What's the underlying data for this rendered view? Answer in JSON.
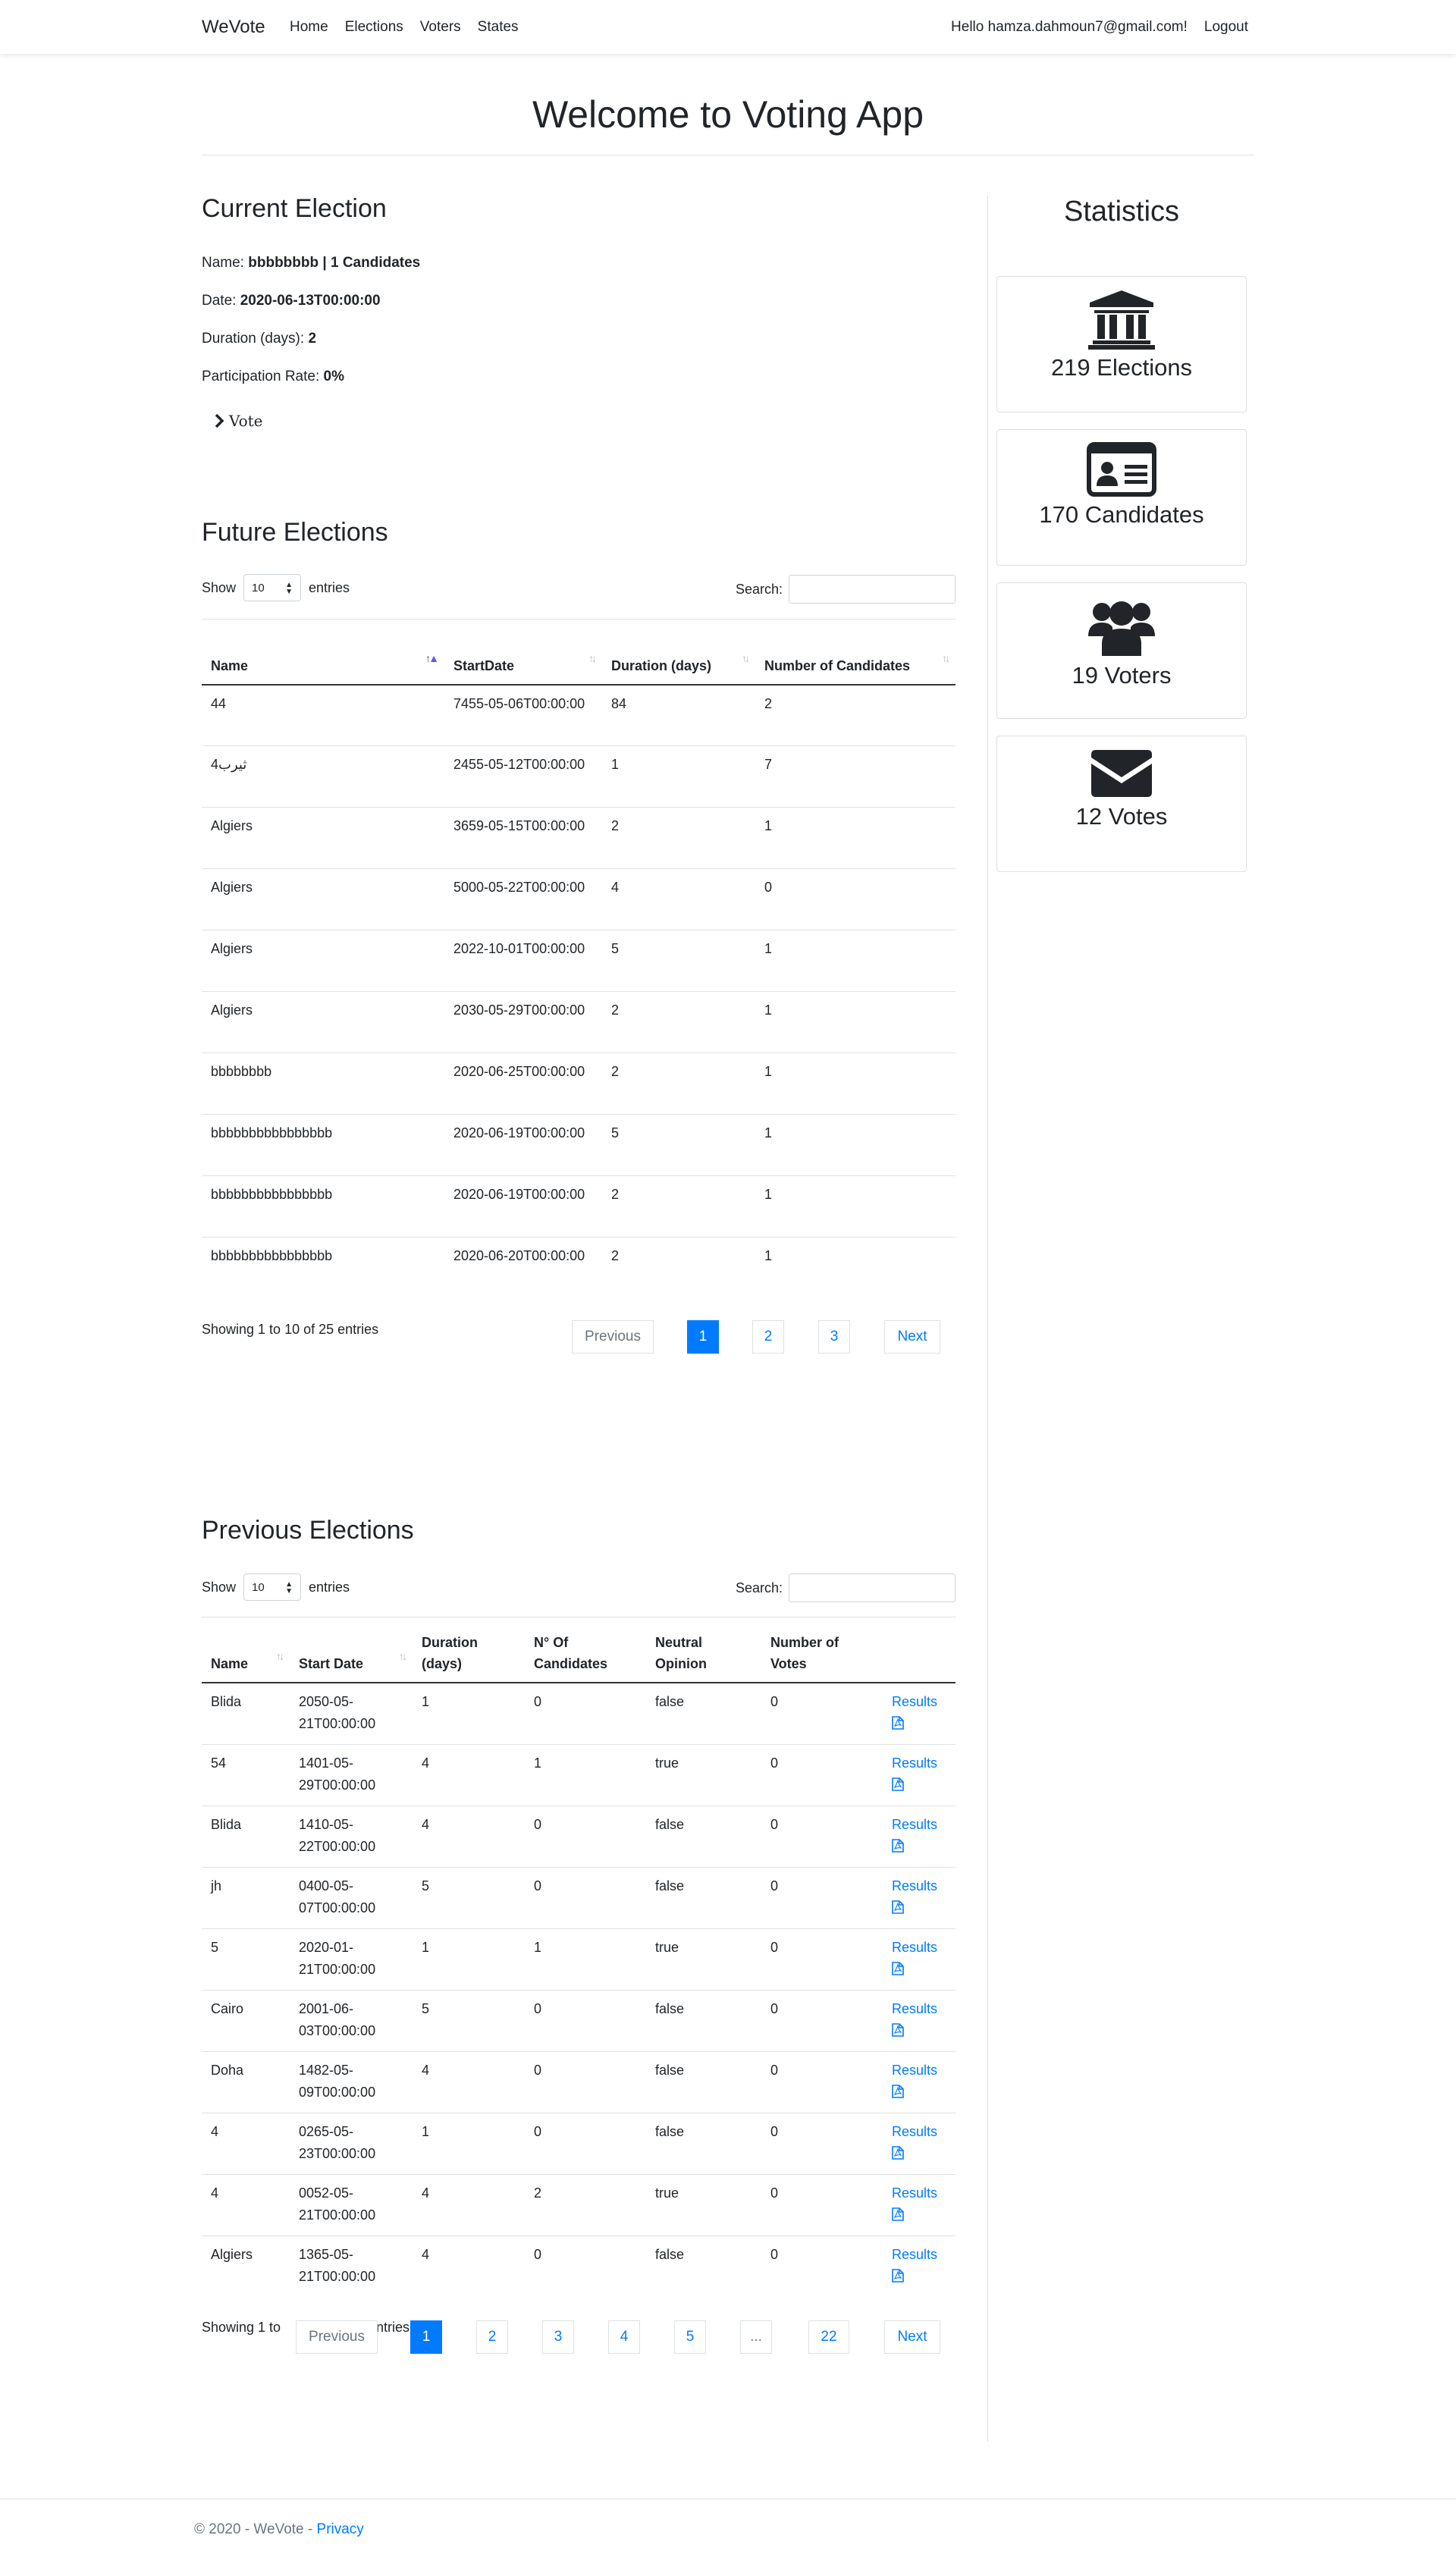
{
  "nav": {
    "brand": "WeVote",
    "links": [
      "Home",
      "Elections",
      "Voters",
      "States"
    ],
    "greeting": "Hello hamza.dahmoun7@gmail.com!",
    "logout": "Logout"
  },
  "hero": {
    "title": "Welcome to Voting App"
  },
  "current": {
    "heading": "Current Election",
    "name_label": "Name: ",
    "name_value": "bbbbbbbb | 1 Candidates",
    "date_label": "Date: ",
    "date_value": "2020-06-13T00:00:00",
    "duration_label": "Duration (days): ",
    "duration_value": "2",
    "participation_label": "Participation Rate: ",
    "participation_value": "0%",
    "vote_label": "Vote"
  },
  "stats": {
    "heading": "Statistics",
    "cards": [
      {
        "icon": "landmark-icon",
        "label": "219 Elections"
      },
      {
        "icon": "id-card-icon",
        "label": "170 Candidates"
      },
      {
        "icon": "users-icon",
        "label": "19 Voters"
      },
      {
        "icon": "envelope-icon",
        "label": "12 Votes"
      }
    ]
  },
  "future": {
    "heading": "Future Elections",
    "show": "Show",
    "entries": "entries",
    "length": "10",
    "search_label": "Search:",
    "columns": [
      "Name",
      "StartDate",
      "Duration (days)",
      "Number of Candidates"
    ],
    "rows": [
      [
        "44",
        "7455-05-06T00:00:00",
        "84",
        "2"
      ],
      [
        "4ثيرب",
        "2455-05-12T00:00:00",
        "1",
        "7"
      ],
      [
        "Algiers",
        "3659-05-15T00:00:00",
        "2",
        "1"
      ],
      [
        "Algiers",
        "5000-05-22T00:00:00",
        "4",
        "0"
      ],
      [
        "Algiers",
        "2022-10-01T00:00:00",
        "5",
        "1"
      ],
      [
        "Algiers",
        "2030-05-29T00:00:00",
        "2",
        "1"
      ],
      [
        "bbbbbbbb",
        "2020-06-25T00:00:00",
        "2",
        "1"
      ],
      [
        "bbbbbbbbbbbbbbbb",
        "2020-06-19T00:00:00",
        "5",
        "1"
      ],
      [
        "bbbbbbbbbbbbbbbb",
        "2020-06-19T00:00:00",
        "2",
        "1"
      ],
      [
        "bbbbbbbbbbbbbbbb",
        "2020-06-20T00:00:00",
        "2",
        "1"
      ]
    ],
    "info": "Showing 1 to 10 of 25 entries",
    "pager": {
      "previous": "Previous",
      "pages": [
        "1",
        "2",
        "3"
      ],
      "next": "Next"
    }
  },
  "previous": {
    "heading": "Previous Elections",
    "show": "Show",
    "entries": "entries",
    "length": "10",
    "search_label": "Search:",
    "columns": [
      "Name",
      "Start Date",
      "Duration (days)",
      "N° Of Candidates",
      "Neutral Opinion",
      "Number of Votes",
      ""
    ],
    "rows": [
      [
        "Blida",
        "2050-05-21T00:00:00",
        "1",
        "0",
        "false",
        "0"
      ],
      [
        "54",
        "1401-05-29T00:00:00",
        "4",
        "1",
        "true",
        "0"
      ],
      [
        "Blida",
        "1410-05-22T00:00:00",
        "4",
        "0",
        "false",
        "0"
      ],
      [
        "jh",
        "0400-05-07T00:00:00",
        "5",
        "0",
        "false",
        "0"
      ],
      [
        "5",
        "2020-01-21T00:00:00",
        "1",
        "1",
        "true",
        "0"
      ],
      [
        "Cairo",
        "2001-06-03T00:00:00",
        "5",
        "0",
        "false",
        "0"
      ],
      [
        "Doha",
        "1482-05-09T00:00:00",
        "4",
        "0",
        "false",
        "0"
      ],
      [
        "4",
        "0265-05-23T00:00:00",
        "1",
        "0",
        "false",
        "0"
      ],
      [
        "4",
        "0052-05-21T00:00:00",
        "4",
        "2",
        "true",
        "0"
      ],
      [
        "Algiers",
        "1365-05-21T00:00:00",
        "4",
        "0",
        "false",
        "0"
      ]
    ],
    "results_label": "Results",
    "info_start": "Showing 1 to",
    "info_end": "ntries",
    "pager": {
      "previous": "Previous",
      "pages": [
        "1",
        "2",
        "3",
        "4",
        "5",
        "...",
        "22"
      ],
      "next": "Next"
    }
  },
  "footer": {
    "copyright": "© 2020 - WeVote - ",
    "privacy": "Privacy"
  }
}
